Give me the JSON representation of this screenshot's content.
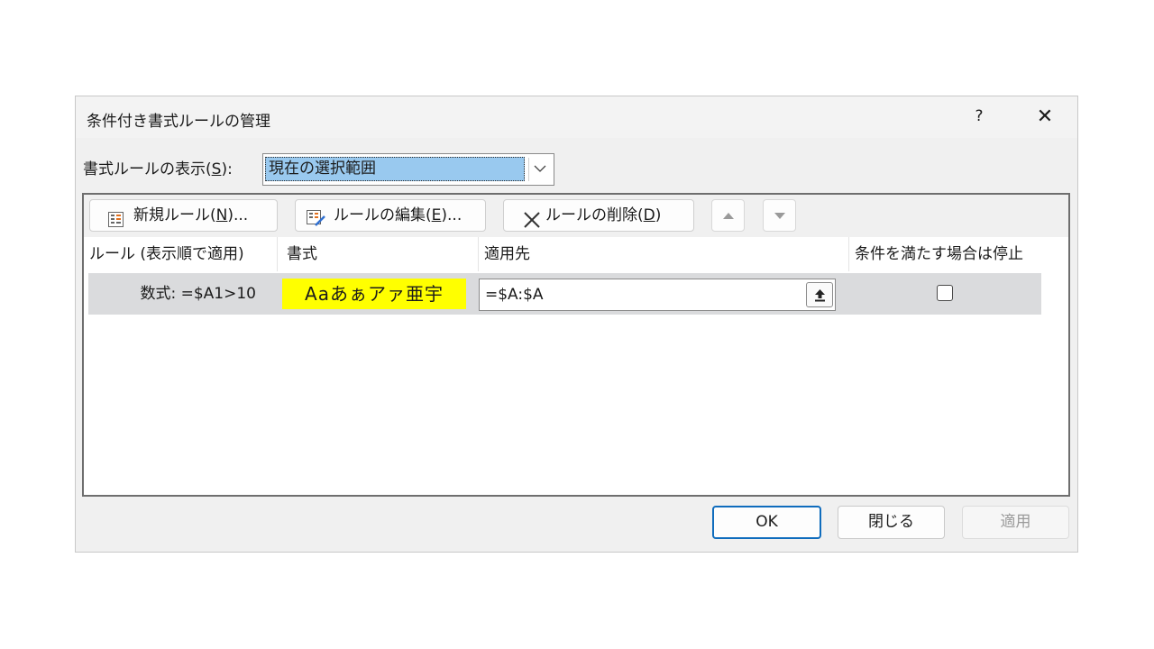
{
  "dialog": {
    "title": "条件付き書式ルールの管理",
    "help_label": "?",
    "close_label": "✕"
  },
  "show_rules": {
    "label_prefix": "書式ルールの表示(",
    "label_key": "S",
    "label_suffix": "):",
    "selected": "現在の選択範囲"
  },
  "toolbar": {
    "new_rule": {
      "prefix": "新規ルール(",
      "key": "N",
      "suffix": ")..."
    },
    "edit_rule": {
      "prefix": "ルールの編集(",
      "key": "E",
      "suffix": ")..."
    },
    "delete_rule": {
      "prefix": "ルールの削除(",
      "key": "D",
      "suffix": ")"
    }
  },
  "columns": [
    "ルール (表示順で適用)",
    "書式",
    "適用先",
    "条件を満たす場合は停止"
  ],
  "rules": [
    {
      "rule": "数式: =$A1>10",
      "format_preview": "Aaあぁアァ亜宇",
      "format_color": "#ffff00",
      "applies_to": "=$A:$A",
      "stop_if_true": false
    }
  ],
  "buttons": {
    "ok": "OK",
    "close": "閉じる",
    "apply": "適用"
  },
  "colors": {
    "selection": "#99c9ef",
    "ok_border": "#0f6cbd",
    "row_highlight": "#dadbdd"
  }
}
